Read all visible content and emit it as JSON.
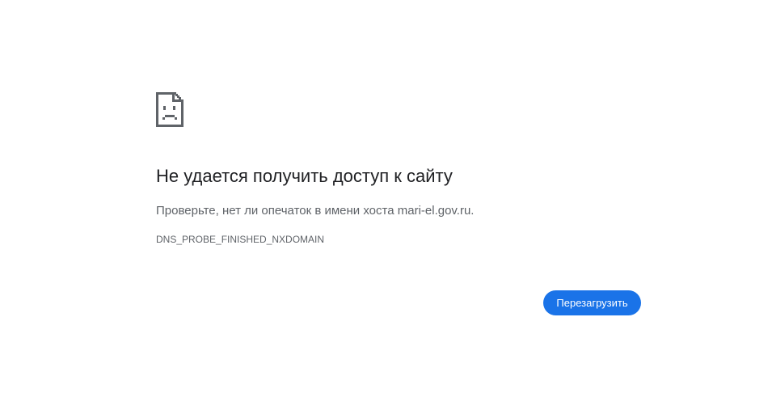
{
  "error_page": {
    "icon": "sad-document-icon",
    "title": "Не удается получить доступ к сайту",
    "message": "Проверьте, нет ли опечаток в имени хоста mari-el.gov.ru.",
    "error_code": "DNS_PROBE_FINISHED_NXDOMAIN",
    "reload_label": "Перезагрузить"
  },
  "colors": {
    "button_bg": "#1a73e8",
    "title_text": "#202124",
    "body_text": "#5f6368"
  }
}
